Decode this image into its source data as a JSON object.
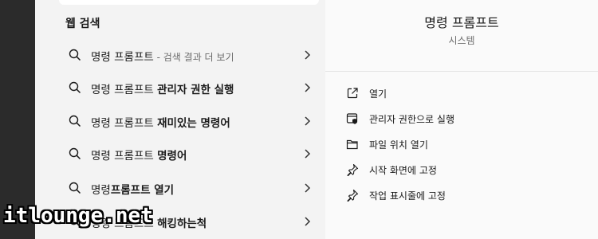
{
  "left": {
    "section_title": "웹 검색",
    "results": [
      {
        "prefix": "명령 프롬프트",
        "bold": "",
        "hint": " - 검색 결과 더 보기"
      },
      {
        "prefix": "명령 프롬프트 ",
        "bold": "관리자 권한 실행",
        "hint": ""
      },
      {
        "prefix": "명령 프롬프트 ",
        "bold": "재미있는 명령어",
        "hint": ""
      },
      {
        "prefix": "명령 프롬프트 ",
        "bold": "명령어",
        "hint": ""
      },
      {
        "prefix": "명령",
        "bold": "프롬프트 열기",
        "hint": ""
      },
      {
        "prefix": "명령 프롬프트 ",
        "bold": "해킹하는척",
        "hint": ""
      }
    ]
  },
  "right": {
    "app_title": "명령 프롬프트",
    "app_subtitle": "시스템",
    "actions": [
      {
        "label": "열기",
        "icon": "open-external-icon"
      },
      {
        "label": "관리자 권한으로 실행",
        "icon": "shield-admin-icon"
      },
      {
        "label": "파일 위치 열기",
        "icon": "folder-icon"
      },
      {
        "label": "시작 화면에 고정",
        "icon": "pin-icon"
      },
      {
        "label": "작업 표시줄에 고정",
        "icon": "pin-icon"
      }
    ]
  },
  "watermark": "itlounge.net",
  "colors": {
    "dark_strip": "#2b2b2b",
    "left_bg": "#f3f3f3",
    "right_bg": "#fafafa"
  }
}
